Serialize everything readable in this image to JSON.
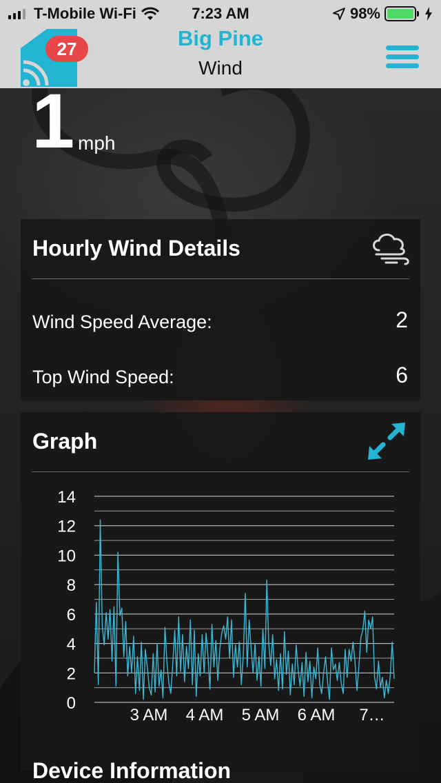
{
  "status_bar": {
    "carrier": "T-Mobile Wi-Fi",
    "time": "7:23 AM",
    "battery": "98%",
    "icons": [
      "signal-icon",
      "wifi-icon",
      "location-arrow-icon",
      "battery-icon",
      "charging-bolt-icon"
    ]
  },
  "header": {
    "badge_count": "27",
    "title": "Big Pine",
    "subtitle": "Wind",
    "accent": "#22b4d2",
    "badge_color": "#e8474a"
  },
  "current": {
    "value": "1",
    "unit": "mph"
  },
  "hourly": {
    "title": "Hourly Wind Details",
    "rows": [
      {
        "label": "Wind Speed Average:",
        "value": "2"
      },
      {
        "label": "Top Wind Speed:",
        "value": "6"
      }
    ]
  },
  "graph": {
    "title": "Graph"
  },
  "chart_data": {
    "type": "line",
    "ylim": [
      0,
      14
    ],
    "yticks": [
      "0",
      "2",
      "4",
      "6",
      "8",
      "10",
      "12",
      "14"
    ],
    "xticks": [
      "3 AM",
      "4 AM",
      "5 AM",
      "6 AM",
      "7…"
    ],
    "grid": true,
    "line_color": "#3db8d4",
    "series": [
      {
        "values": [
          2,
          6.8,
          1.2,
          12.4,
          5.2,
          3.9,
          6.1,
          4.3,
          6.3,
          2.8,
          6.5,
          1.1,
          10.2,
          5.9,
          6.4,
          3.1,
          5.5,
          1.8,
          3.8,
          2.0,
          4.5,
          0.6,
          3.1,
          0.8,
          4.1,
          0.2,
          3.6,
          2.4,
          1.0,
          0.5,
          3.3,
          0.7,
          4.0,
          1.1,
          2.2,
          0.3,
          5.1,
          2.8,
          1.3,
          0.6,
          2.6,
          4.9,
          1.8,
          5.8,
          2.1,
          4.6,
          1.4,
          3.8,
          2.3,
          5.6,
          1.2,
          4.9,
          0.4,
          3.3,
          1.8,
          4.6,
          2.0,
          4.7,
          3.1,
          0.9,
          5.3,
          2.4,
          4.2,
          1.5,
          3.6,
          4.7,
          5.2,
          4.3,
          5.8,
          3.0,
          5.6,
          1.7,
          3.9,
          2.4,
          4.1,
          1.2,
          3.2,
          7.4,
          2.4,
          5.6,
          3.6,
          2.0,
          4.0,
          1.5,
          3.1,
          1.1,
          5.0,
          2.3,
          8.3,
          4.0,
          2.5,
          4.6,
          1.6,
          2.9,
          0.8,
          3.3,
          0.9,
          4.8,
          1.9,
          3.5,
          0.5,
          2.6,
          1.2,
          3.9,
          2.2,
          1.1,
          2.7,
          0.4,
          3.4,
          1.4,
          2.8,
          0.3,
          2.4,
          1.6,
          3.7,
          1.2,
          0.6,
          2.0,
          3.1,
          1.4,
          0.2,
          3.7,
          2.2,
          2.6,
          1.5,
          2.7,
          1.3,
          0.6,
          3.6,
          1.7,
          3.6,
          2.8,
          4.1,
          2.8,
          0.8,
          2.4,
          4.4,
          4.9,
          6.2,
          3.4,
          5.6,
          5.0,
          5.8,
          1.7,
          0.9,
          2.8,
          1.0,
          1.7,
          0.3,
          1.5,
          0.6,
          1.8,
          4.1,
          1.6
        ]
      }
    ]
  },
  "device": {
    "title": "Device Information"
  },
  "icons": {
    "logo": "house-signal-icon",
    "menu": "hamburger-menu-icon",
    "weather": "cloud-wind-icon",
    "expand": "expand-arrows-icon"
  }
}
